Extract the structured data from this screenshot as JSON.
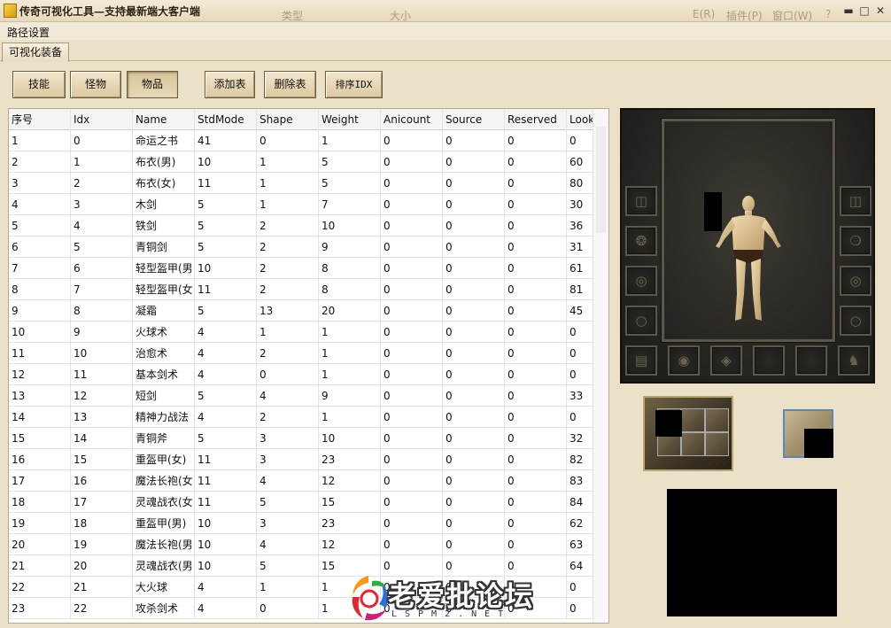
{
  "window": {
    "title": "传奇可视化工具—支持最新端大客户端",
    "behind_columns": [
      "类型",
      "大小"
    ],
    "behind_menus": [
      "E(R)",
      "插件(P)",
      "窗口(W)",
      "?"
    ],
    "controls": {
      "minimize": "▬",
      "maximize": "□",
      "close": "✕"
    }
  },
  "menubar": {
    "items": [
      "路径设置"
    ]
  },
  "tabs": [
    {
      "label": "可视化装备",
      "active": true
    }
  ],
  "toolbar": {
    "buttons": [
      {
        "id": "skill",
        "label": "技能",
        "pressed": false
      },
      {
        "id": "monster",
        "label": "怪物",
        "pressed": false
      },
      {
        "id": "item",
        "label": "物品",
        "pressed": true
      },
      {
        "id": "add",
        "label": "添加表",
        "pressed": false
      },
      {
        "id": "delete",
        "label": "删除表",
        "pressed": false
      },
      {
        "id": "sort",
        "label": "排序IDX",
        "pressed": false
      }
    ]
  },
  "grid": {
    "columns": [
      "序号",
      "Idx",
      "Name",
      "StdMode",
      "Shape",
      "Weight",
      "Anicount",
      "Source",
      "Reserved",
      "Look"
    ],
    "rows": [
      [
        "1",
        "0",
        "命运之书",
        "41",
        "0",
        "1",
        "0",
        "0",
        "0",
        "0"
      ],
      [
        "2",
        "1",
        "布衣(男)",
        "10",
        "1",
        "5",
        "0",
        "0",
        "0",
        "60"
      ],
      [
        "3",
        "2",
        "布衣(女)",
        "11",
        "1",
        "5",
        "0",
        "0",
        "0",
        "80"
      ],
      [
        "4",
        "3",
        "木剑",
        "5",
        "1",
        "7",
        "0",
        "0",
        "0",
        "30"
      ],
      [
        "5",
        "4",
        "铁剑",
        "5",
        "2",
        "10",
        "0",
        "0",
        "0",
        "36"
      ],
      [
        "6",
        "5",
        "青铜剑",
        "5",
        "2",
        "9",
        "0",
        "0",
        "0",
        "31"
      ],
      [
        "7",
        "6",
        "轻型盔甲(男",
        "10",
        "2",
        "8",
        "0",
        "0",
        "0",
        "61"
      ],
      [
        "8",
        "7",
        "轻型盔甲(女",
        "11",
        "2",
        "8",
        "0",
        "0",
        "0",
        "81"
      ],
      [
        "9",
        "8",
        "凝霜",
        "5",
        "13",
        "20",
        "0",
        "0",
        "0",
        "45"
      ],
      [
        "10",
        "9",
        "火球术",
        "4",
        "1",
        "1",
        "0",
        "0",
        "0",
        "0"
      ],
      [
        "11",
        "10",
        "治愈术",
        "4",
        "2",
        "1",
        "0",
        "0",
        "0",
        "0"
      ],
      [
        "12",
        "11",
        "基本剑术",
        "4",
        "0",
        "1",
        "0",
        "0",
        "0",
        "0"
      ],
      [
        "13",
        "12",
        "短剑",
        "5",
        "4",
        "9",
        "0",
        "0",
        "0",
        "33"
      ],
      [
        "14",
        "13",
        "精神力战法",
        "4",
        "2",
        "1",
        "0",
        "0",
        "0",
        "0"
      ],
      [
        "15",
        "14",
        "青铜斧",
        "5",
        "3",
        "10",
        "0",
        "0",
        "0",
        "32"
      ],
      [
        "16",
        "15",
        "重盔甲(女)",
        "11",
        "3",
        "23",
        "0",
        "0",
        "0",
        "82"
      ],
      [
        "17",
        "16",
        "魔法长袍(女",
        "11",
        "4",
        "12",
        "0",
        "0",
        "0",
        "83"
      ],
      [
        "18",
        "17",
        "灵魂战衣(女",
        "11",
        "5",
        "15",
        "0",
        "0",
        "0",
        "84"
      ],
      [
        "19",
        "18",
        "重盔甲(男)",
        "10",
        "3",
        "23",
        "0",
        "0",
        "0",
        "62"
      ],
      [
        "20",
        "19",
        "魔法长袍(男",
        "10",
        "4",
        "12",
        "0",
        "0",
        "0",
        "63"
      ],
      [
        "21",
        "20",
        "灵魂战衣(男",
        "10",
        "5",
        "15",
        "0",
        "0",
        "0",
        "64"
      ],
      [
        "22",
        "21",
        "大火球",
        "4",
        "1",
        "1",
        "0",
        "0",
        "0",
        "0"
      ],
      [
        "23",
        "22",
        "攻杀剑术",
        "4",
        "0",
        "1",
        "0",
        "0",
        "0",
        "0"
      ]
    ]
  },
  "watermark": {
    "text": "老爱批论坛",
    "sub": "LSPM2.NET"
  },
  "colors": {
    "panel_dark": "#24221e",
    "app_bg": "#ebe0c8",
    "tile_border_blue": "#5a88b8"
  },
  "equipment_slots": [
    "helmet-slot",
    "necklace-slot",
    "bracelet-left-slot",
    "ring-left-slot",
    "medal-slot",
    "bracelet-right-slot",
    "ring-right-slot",
    "amulet-slot",
    "belt-slot",
    "boots-slot",
    "gem-slot",
    "charm-slot",
    "bag-slot",
    "horse-slot"
  ]
}
